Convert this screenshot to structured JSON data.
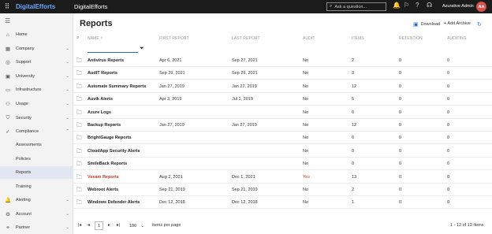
{
  "topbar": {
    "waffle_icon": "⠿",
    "logo": "DigitalEfforts",
    "app_name": "DigitalEfforts",
    "search_placeholder": "Ask a question...",
    "user_name": "Azurative Admin",
    "avatar_initials": "AA"
  },
  "sidebar": {
    "items": [
      {
        "label": "Home",
        "icon": "⌂"
      },
      {
        "label": "Company",
        "icon": "▦",
        "chevron": "⌄"
      },
      {
        "label": "Support",
        "icon": "◎",
        "chevron": "⌄"
      },
      {
        "label": "University",
        "icon": "▣",
        "chevron": "⌄"
      },
      {
        "label": "Infrastructure",
        "icon": "▭",
        "chevron": "⌄"
      },
      {
        "label": "Usage",
        "icon": "⚇",
        "chevron": "⌄"
      },
      {
        "label": "Security",
        "icon": "⛉",
        "chevron": "⌄"
      },
      {
        "label": "Compliance",
        "icon": "✓",
        "chevron": "⌃"
      },
      {
        "label": "Assessments"
      },
      {
        "label": "Policies"
      },
      {
        "label": "Reports"
      },
      {
        "label": "Training"
      },
      {
        "label": "Alerting",
        "icon": "🔔",
        "chevron": "⌄"
      },
      {
        "label": "Account",
        "icon": "⚙",
        "chevron": "⌄"
      },
      {
        "label": "Partner",
        "icon": "⚭",
        "chevron": "⌄"
      }
    ]
  },
  "page": {
    "title": "Reports",
    "download_label": "Download",
    "add_archive_label": "+ Add Archive"
  },
  "table": {
    "headers": {
      "name": "NAME",
      "first": "FIRST REPORT",
      "last": "LAST REPORT",
      "audit": "AUDIT",
      "items": "ITEMS",
      "retention": "RETENTION",
      "auditing": "AUDITING"
    },
    "rows": [
      {
        "name": "Antivirus Reports",
        "first": "Apr 6, 2021",
        "last": "Sep 27, 2021",
        "audit": "No",
        "items": "2",
        "retention": "0",
        "auditing": "0"
      },
      {
        "name": "AudIT Reports",
        "first": "Sep 29, 2021",
        "last": "Sep 29, 2021",
        "audit": "No",
        "items": "3",
        "retention": "0",
        "auditing": "0"
      },
      {
        "name": "Automate Summary Reports",
        "first": "Jan 27, 2019",
        "last": "Jan 27, 2019",
        "audit": "No",
        "items": "12",
        "retention": "0",
        "auditing": "0"
      },
      {
        "name": "Auvik Alerts",
        "first": "Apr 3, 2019",
        "last": "Jul 1, 2019",
        "audit": "No",
        "items": "5",
        "retention": "0",
        "auditing": "0"
      },
      {
        "name": "Azure Logs",
        "first": "",
        "last": "",
        "audit": "No",
        "items": "0",
        "retention": "0",
        "auditing": "0"
      },
      {
        "name": "Backup Reports",
        "first": "Jan 27, 2019",
        "last": "Jan 27, 2019",
        "audit": "No",
        "items": "12",
        "retention": "0",
        "auditing": "0"
      },
      {
        "name": "BrightGauge Reports",
        "first": "",
        "last": "",
        "audit": "No",
        "items": "0",
        "retention": "0",
        "auditing": "0"
      },
      {
        "name": "CloudApp Security Alerts",
        "first": "",
        "last": "",
        "audit": "No",
        "items": "0",
        "retention": "0",
        "auditing": "0"
      },
      {
        "name": "SmileBack Reports",
        "first": "",
        "last": "",
        "audit": "No",
        "items": "0",
        "retention": "0",
        "auditing": "0"
      },
      {
        "name": "Veeam Reports",
        "first": "Aug 2, 2021",
        "last": "Dec 1, 2021",
        "audit": "Yes",
        "items": "13",
        "retention": "0",
        "auditing": "0",
        "alert": true
      },
      {
        "name": "Webroot Alerts",
        "first": "Sep 21, 2019",
        "last": "Sep 21, 2019",
        "audit": "No",
        "items": "2",
        "retention": "0",
        "auditing": "0"
      },
      {
        "name": "Windows Defender Alerts",
        "first": "Dec 12, 2018",
        "last": "Dec 12, 2018",
        "audit": "No",
        "items": "1",
        "retention": "0",
        "auditing": "0"
      }
    ]
  },
  "pager": {
    "first": "|◂",
    "prev": "◂",
    "page": "1",
    "next": "▸",
    "last": "▸|",
    "page_size": "100",
    "items_per_page": "items per page",
    "summary": "1 - 12 of 12 items"
  },
  "colors": {
    "accent": "#2a6dc9",
    "alert": "#c0392b",
    "avatar": "#d8524a"
  }
}
